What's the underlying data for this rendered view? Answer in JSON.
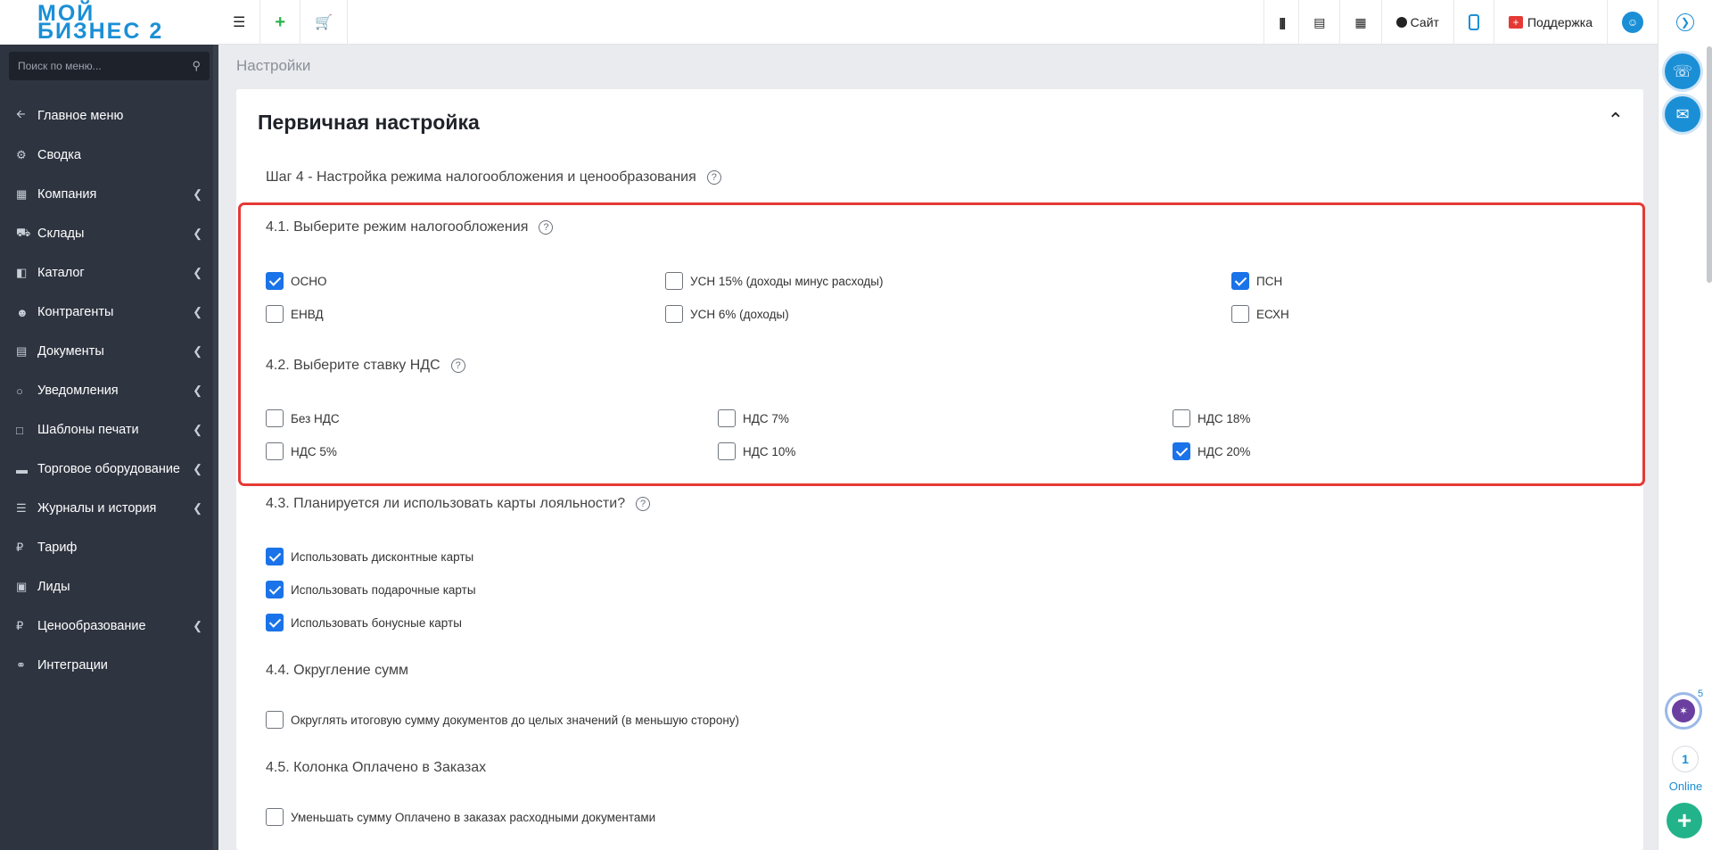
{
  "logo": {
    "line1": "МОЙ",
    "line2": "БИЗНЕС 2"
  },
  "search": {
    "placeholder": "Поиск по меню..."
  },
  "sidebar": {
    "items": [
      {
        "label": "Главное меню",
        "icon": "arrow-left-icon",
        "has_submenu": false
      },
      {
        "label": "Сводка",
        "icon": "gear-icon",
        "has_submenu": false
      },
      {
        "label": "Компания",
        "icon": "bar-chart-icon",
        "has_submenu": true
      },
      {
        "label": "Склады",
        "icon": "truck-icon",
        "has_submenu": true
      },
      {
        "label": "Каталог",
        "icon": "folder-icon",
        "has_submenu": true
      },
      {
        "label": "Контрагенты",
        "icon": "users-icon",
        "has_submenu": true
      },
      {
        "label": "Документы",
        "icon": "document-icon",
        "has_submenu": true
      },
      {
        "label": "Уведомления",
        "icon": "chat-icon",
        "has_submenu": true
      },
      {
        "label": "Шаблоны печати",
        "icon": "template-icon",
        "has_submenu": true
      },
      {
        "label": "Торговое оборудование",
        "icon": "inbox-icon",
        "has_submenu": true
      },
      {
        "label": "Журналы и история",
        "icon": "list-icon",
        "has_submenu": true
      },
      {
        "label": "Тариф",
        "icon": "ruble-icon",
        "has_submenu": false
      },
      {
        "label": "Лиды",
        "icon": "contact-icon",
        "has_submenu": false
      },
      {
        "label": "Ценообразование",
        "icon": "ruble-icon",
        "has_submenu": true
      },
      {
        "label": "Интеграции",
        "icon": "paperclip-icon",
        "has_submenu": false
      }
    ]
  },
  "topbar": {
    "site_label": "Сайт",
    "support_label": "Поддержка"
  },
  "rail": {
    "badge": "5",
    "online_count": "1",
    "online_label": "Online"
  },
  "breadcrumb": "Настройки",
  "card": {
    "title": "Первичная настройка",
    "step": "Шаг 4 - Настройка режима налогообложения и ценообразования",
    "s41": {
      "title": "4.1. Выберите режим налогообложения",
      "options": [
        {
          "label": "ОСНО",
          "checked": true
        },
        {
          "label": "УСН 15% (доходы минус расходы)",
          "checked": false
        },
        {
          "label": "ПСН",
          "checked": true
        },
        {
          "label": "ЕНВД",
          "checked": false
        },
        {
          "label": "УСН 6% (доходы)",
          "checked": false
        },
        {
          "label": "ЕСХН",
          "checked": false
        }
      ]
    },
    "s42": {
      "title": "4.2. Выберите ставку НДС",
      "options": [
        {
          "label": "Без НДС",
          "checked": false
        },
        {
          "label": "НДС 7%",
          "checked": false
        },
        {
          "label": "НДС 18%",
          "checked": false
        },
        {
          "label": "НДС 5%",
          "checked": false
        },
        {
          "label": "НДС 10%",
          "checked": false
        },
        {
          "label": "НДС 20%",
          "checked": true
        }
      ]
    },
    "s43": {
      "title": "4.3. Планируется ли использовать карты лояльности?",
      "options": [
        {
          "label": "Использовать дисконтные карты",
          "checked": true
        },
        {
          "label": "Использовать подарочные карты",
          "checked": true
        },
        {
          "label": "Использовать бонусные карты",
          "checked": true
        }
      ]
    },
    "s44": {
      "title": "4.4. Округление сумм",
      "options": [
        {
          "label": "Округлять итоговую сумму документов до целых значений (в меньшую сторону)",
          "checked": false
        }
      ]
    },
    "s45": {
      "title": "4.5. Колонка Оплачено в Заказах",
      "options": [
        {
          "label": "Уменьшать сумму Оплачено в заказах расходными документами",
          "checked": false
        }
      ]
    }
  },
  "colors": {
    "sidebar_bg": "#2e3440",
    "accent": "#1b8fd6",
    "checkbox": "#1a73e8",
    "highlight": "#e53935"
  }
}
